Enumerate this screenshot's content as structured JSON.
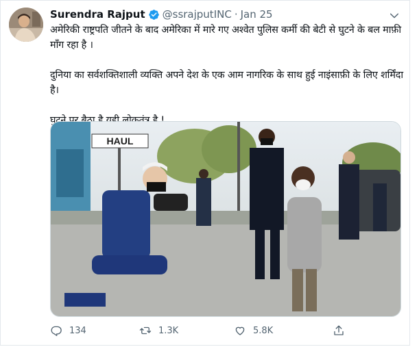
{
  "tweet": {
    "author_name": "Surendra Rajput",
    "handle": "@ssrajputINC",
    "separator": "·",
    "date": "Jan 25",
    "text": [
      "अमेरिकी राष्ट्रपति जीतने के बाद अमेरिका में मारे गए अश्वेत पुलिस कर्मी की बेटी से घुटने के बल माफ़ी माँग रहा है ।",
      "दुनिया का सर्वशक्तिशाली व्यक्ति अपने देश के एक आम नागरिक के साथ हुई नाइंसाफ़ी के लिए शर्मिंदा है।",
      "घुटने पर बैठा है यही लोकतंत्र है !"
    ],
    "photo_sign_text": "HAUL",
    "stats": {
      "replies": "134",
      "retweets": "1.3K",
      "likes": "5.8K"
    }
  },
  "icons": {
    "verified": "verified-badge-icon",
    "more": "chevron-down-icon",
    "reply": "reply-icon",
    "retweet": "retweet-icon",
    "like": "heart-icon",
    "share": "share-icon"
  },
  "colors": {
    "text_primary": "#0f1419",
    "text_secondary": "#536471",
    "verified_blue": "#1d9bf0",
    "border": "#e3e8ec"
  }
}
